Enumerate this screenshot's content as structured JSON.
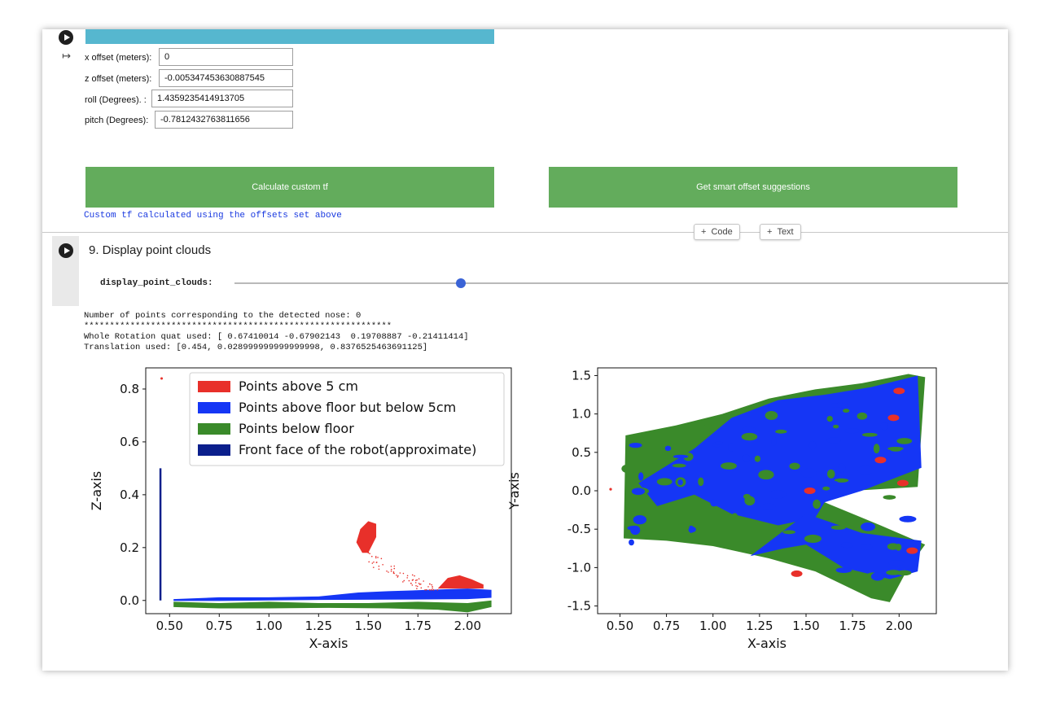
{
  "cell8": {
    "form": [
      {
        "label": "x offset (meters):",
        "value": "0"
      },
      {
        "label": "z offset (meters):",
        "value": "-0.005347453630887545"
      },
      {
        "label": "roll (Degrees). :",
        "value": "1.4359235414913705"
      },
      {
        "label": "pitch (Degrees):",
        "value": "-0.7812432763811656"
      }
    ],
    "buttons": {
      "calculate": "Calculate custom tf",
      "suggest": "Get smart offset suggestions"
    },
    "message": "Custom tf calculated using the offsets set above"
  },
  "toolbar": {
    "add_code": "Code",
    "add_text": "Text"
  },
  "cell9": {
    "title": "9. Display point clouds",
    "slider_label": "display_point_clouds:",
    "output": [
      "Number of points corresponding to the detected nose: 0",
      "************************************************************",
      "Whole Rotation quat used: [ 0.67410014 -0.67902143  0.19708887 -0.21411414]",
      "Translation used: [0.454, 0.028999999999999998, 0.8376525463691125]"
    ]
  },
  "chart_data": [
    {
      "type": "scatter",
      "xlabel": "X-axis",
      "ylabel": "Z-axis",
      "xlim": [
        0.38,
        2.22
      ],
      "ylim": [
        -0.05,
        0.88
      ],
      "xticks": [
        "0.50",
        "0.75",
        "1.00",
        "1.25",
        "1.50",
        "1.75",
        "2.00"
      ],
      "yticks": [
        "0.0",
        "0.2",
        "0.4",
        "0.6",
        "0.8"
      ],
      "legend_position": "top-right",
      "legend": [
        {
          "label": "Points above 5 cm",
          "color": "#e8302a"
        },
        {
          "label": "Points above floor but below 5cm",
          "color": "#1536f5"
        },
        {
          "label": "Points below floor",
          "color": "#3a8a2a"
        },
        {
          "label": "Front face of the robot(approximate)",
          "color": "#0b1f8c"
        }
      ],
      "series": [
        {
          "name": "Points above 5 cm",
          "color": "#e8302a",
          "x": [
            0.46,
            1.45,
            1.49,
            1.53,
            1.52,
            1.55,
            1.6,
            1.65,
            1.7,
            1.9,
            2.0
          ],
          "y": [
            0.84,
            0.21,
            0.28,
            0.3,
            0.22,
            0.17,
            0.12,
            0.07,
            0.05,
            0.09,
            0.07
          ]
        },
        {
          "name": "Points above floor but below 5cm",
          "color": "#1536f5",
          "x": [
            0.55,
            0.75,
            1.0,
            1.25,
            1.5,
            1.75,
            2.0,
            2.12
          ],
          "y": [
            0.005,
            0.008,
            0.012,
            0.018,
            0.028,
            0.035,
            0.04,
            0.03
          ]
        },
        {
          "name": "Points below floor",
          "color": "#3a8a2a",
          "x": [
            0.55,
            0.75,
            1.0,
            1.25,
            1.5,
            1.75,
            2.0,
            2.1
          ],
          "y": [
            -0.02,
            -0.02,
            -0.015,
            -0.02,
            -0.02,
            -0.015,
            -0.03,
            -0.02
          ]
        },
        {
          "name": "Front face of the robot(approximate)",
          "color": "#0b1f8c",
          "x": [
            0.454,
            0.454
          ],
          "y": [
            0.0,
            0.5
          ]
        }
      ]
    },
    {
      "type": "scatter",
      "xlabel": "X-axis",
      "ylabel": "Y-axis",
      "xlim": [
        0.38,
        2.2
      ],
      "ylim": [
        -1.6,
        1.6
      ],
      "xticks": [
        "0.50",
        "0.75",
        "1.00",
        "1.25",
        "1.50",
        "1.75",
        "2.00"
      ],
      "yticks": [
        "-1.5",
        "-1.0",
        "-0.5",
        "0.0",
        "0.5",
        "1.0",
        "1.5"
      ],
      "series": [
        {
          "name": "Points below floor",
          "color": "#3a8a2a",
          "x": [
            0.52,
            1.0,
            1.5,
            1.95
          ],
          "y": [
            0.7,
            1.05,
            1.25,
            -1.45
          ]
        },
        {
          "name": "Points above floor but below 5cm",
          "color": "#1536f5",
          "x": [
            0.6,
            1.2,
            2.1,
            2.1
          ],
          "y": [
            0.0,
            0.6,
            1.5,
            -0.7
          ]
        },
        {
          "name": "Points above 5 cm",
          "color": "#e8302a",
          "x": [
            0.45,
            1.55,
            1.9,
            2.05
          ],
          "y": [
            0.02,
            0.0,
            0.4,
            1.3
          ]
        }
      ]
    }
  ]
}
